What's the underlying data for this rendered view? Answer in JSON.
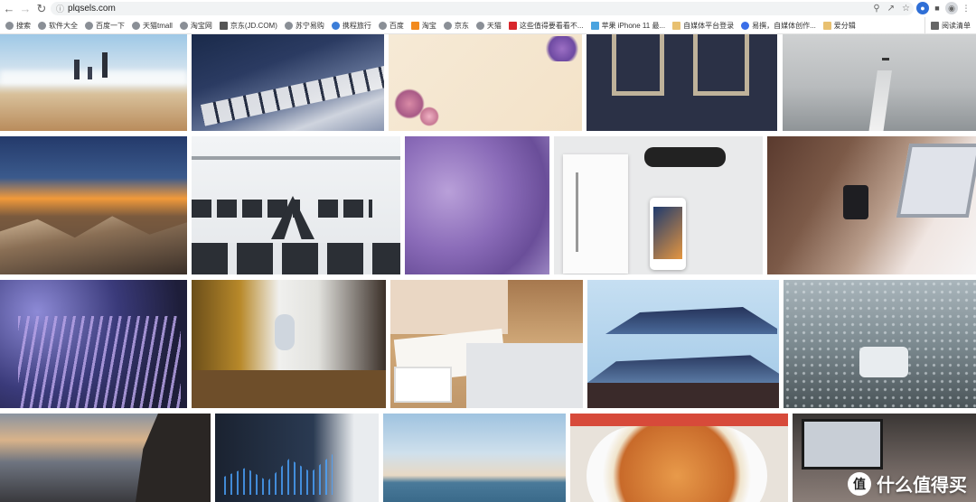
{
  "browser": {
    "url": "plqsels.com",
    "bookmarks": [
      {
        "label": "搜索"
      },
      {
        "label": "软件大全"
      },
      {
        "label": "百度一下"
      },
      {
        "label": "天猫tmall"
      },
      {
        "label": "淘宝网"
      },
      {
        "label": "京东(JD.COM)"
      },
      {
        "label": "苏宁易购"
      },
      {
        "label": "携程旅行"
      },
      {
        "label": "百度"
      },
      {
        "label": "淘宝"
      },
      {
        "label": "京东"
      },
      {
        "label": "天猫"
      },
      {
        "label": "这些值得要看看不..."
      },
      {
        "label": "苹果 iPhone 11 最..."
      },
      {
        "label": "自媒体平台登录"
      },
      {
        "label": "易撰，自媒体创作..."
      },
      {
        "label": "爱分辑"
      }
    ],
    "reader_label": "阅读清单"
  },
  "watermark": {
    "text": "什么值得买",
    "badge": "值"
  },
  "photos": [
    {
      "subject": "beach-family"
    },
    {
      "subject": "piano-keys"
    },
    {
      "subject": "floral-paper"
    },
    {
      "subject": "frames-on-wall"
    },
    {
      "subject": "road-fog"
    },
    {
      "subject": "mountain-sunset"
    },
    {
      "subject": "white-building"
    },
    {
      "subject": "purple-watercolor"
    },
    {
      "subject": "desk-flatlay"
    },
    {
      "subject": "woman-laptop"
    },
    {
      "subject": "lavender"
    },
    {
      "subject": "child-window"
    },
    {
      "subject": "writing-desk"
    },
    {
      "subject": "pagoda-roof"
    },
    {
      "subject": "rainy-window"
    },
    {
      "subject": "rocky-shore-sunset"
    },
    {
      "subject": "stock-chart"
    },
    {
      "subject": "sea-sky"
    },
    {
      "subject": "pizza"
    },
    {
      "subject": "laptop-hands"
    }
  ]
}
